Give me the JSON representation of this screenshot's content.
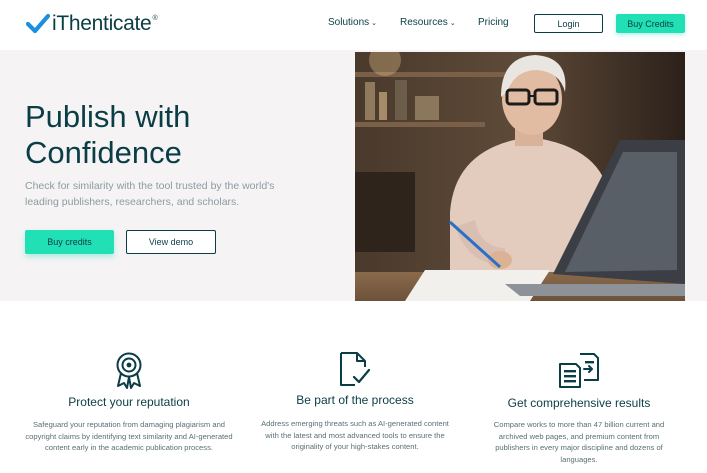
{
  "brand": {
    "name": "iThenticate",
    "registered_mark": "®",
    "accent_color": "#21e0b5",
    "primary_color": "#0a3d45",
    "logo_icon": "checkmark-icon"
  },
  "nav": {
    "items": [
      {
        "label": "Solutions",
        "has_dropdown": true
      },
      {
        "label": "Resources",
        "has_dropdown": true
      },
      {
        "label": "Pricing",
        "has_dropdown": false
      }
    ],
    "dropdown_icon": "chevron-down-icon",
    "login_label": "Login",
    "buy_label": "Buy Credits"
  },
  "hero": {
    "title_line1": "Publish with",
    "title_line2": "Confidence",
    "subtitle": "Check for similarity with the tool trusted by the world's leading publishers, researchers, and scholars.",
    "primary_button": "Buy credits",
    "secondary_button": "View demo"
  },
  "features": [
    {
      "icon": "award-ribbon-icon",
      "title": "Protect your reputation",
      "description": "Safeguard your reputation from damaging plagiarism and copyright claims by identifying text similarity and AI-generated content early in the academic publication process."
    },
    {
      "icon": "document-check-icon",
      "title": "Be part of the process",
      "description": "Address emerging threats such as AI-generated content with the latest and most advanced tools to ensure the originality of your high-stakes content."
    },
    {
      "icon": "documents-compare-icon",
      "title": "Get comprehensive results",
      "description": "Compare works to more than 47 billion current and archived web pages, and premium content from publishers in every major discipline and dozens of languages."
    }
  ]
}
